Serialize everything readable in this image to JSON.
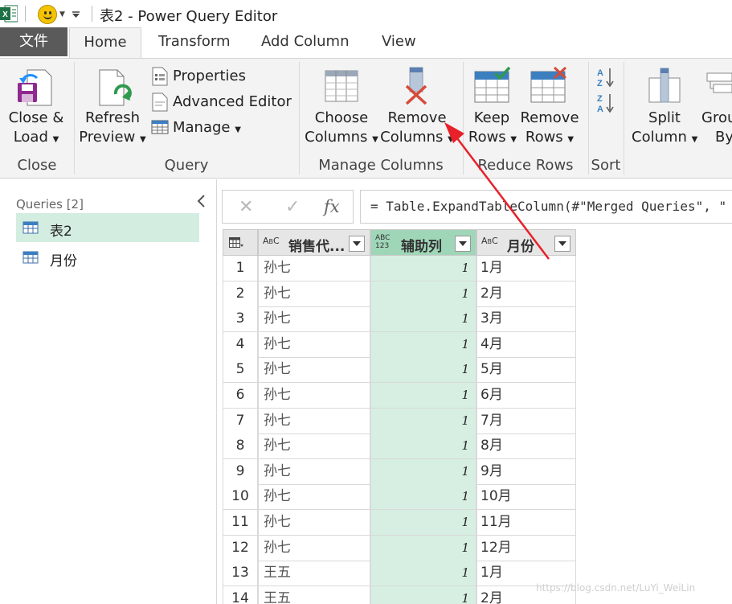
{
  "app_icon": "excel-icon",
  "window_title": "表2 - Power Query Editor",
  "tabs": {
    "file": "文件",
    "items": [
      "Home",
      "Transform",
      "Add Column",
      "View"
    ],
    "active": "Home"
  },
  "ribbon": {
    "close_load": [
      "Close &",
      "Load"
    ],
    "refresh_preview": [
      "Refresh",
      "Preview"
    ],
    "properties": "Properties",
    "advanced_editor": "Advanced Editor",
    "manage": "Manage",
    "choose_columns": [
      "Choose",
      "Columns"
    ],
    "remove_columns": [
      "Remove",
      "Columns"
    ],
    "keep_rows": [
      "Keep",
      "Rows"
    ],
    "remove_rows": [
      "Remove",
      "Rows"
    ],
    "split_column": [
      "Split",
      "Column"
    ],
    "group_by": [
      "Grou",
      "By"
    ],
    "groups": {
      "close": "Close",
      "query": "Query",
      "manage_columns": "Manage Columns",
      "reduce_rows": "Reduce Rows",
      "sort": "Sort"
    }
  },
  "queries": {
    "header": "Queries [2]",
    "items": [
      "表2",
      "月份"
    ],
    "selected": "表2"
  },
  "formula_bar": {
    "fx": "fx",
    "formula": "= Table.ExpandTableColumn(#\"Merged Queries\", \""
  },
  "grid": {
    "columns": [
      {
        "type_top": "A",
        "type_bottom": "B",
        "type_sub": "C",
        "name": "销售代..."
      },
      {
        "type_top": "ABC",
        "type_bottom": "123",
        "name": "辅助列"
      },
      {
        "type_top": "A",
        "type_bottom": "B",
        "type_sub": "C",
        "name": "月份"
      }
    ],
    "rows": [
      {
        "n": "1",
        "name": "孙七",
        "aux": "1",
        "month": "1月"
      },
      {
        "n": "2",
        "name": "孙七",
        "aux": "1",
        "month": "2月"
      },
      {
        "n": "3",
        "name": "孙七",
        "aux": "1",
        "month": "3月"
      },
      {
        "n": "4",
        "name": "孙七",
        "aux": "1",
        "month": "4月"
      },
      {
        "n": "5",
        "name": "孙七",
        "aux": "1",
        "month": "5月"
      },
      {
        "n": "6",
        "name": "孙七",
        "aux": "1",
        "month": "6月"
      },
      {
        "n": "7",
        "name": "孙七",
        "aux": "1",
        "month": "7月"
      },
      {
        "n": "8",
        "name": "孙七",
        "aux": "1",
        "month": "8月"
      },
      {
        "n": "9",
        "name": "孙七",
        "aux": "1",
        "month": "9月"
      },
      {
        "n": "10",
        "name": "孙七",
        "aux": "1",
        "month": "10月"
      },
      {
        "n": "11",
        "name": "孙七",
        "aux": "1",
        "month": "11月"
      },
      {
        "n": "12",
        "name": "孙七",
        "aux": "1",
        "month": "12月"
      },
      {
        "n": "13",
        "name": "王五",
        "aux": "1",
        "month": "1月"
      },
      {
        "n": "14",
        "name": "王五",
        "aux": "1",
        "month": "2月"
      }
    ]
  },
  "watermark": "https://blog.csdn.net/LuYi_WeiLin",
  "colors": {
    "accent_green": "#9fd6b8",
    "selected_query": "#d3ede0",
    "annotation_arrow": "#e8202a",
    "file_tab": "#5a5a5a"
  }
}
